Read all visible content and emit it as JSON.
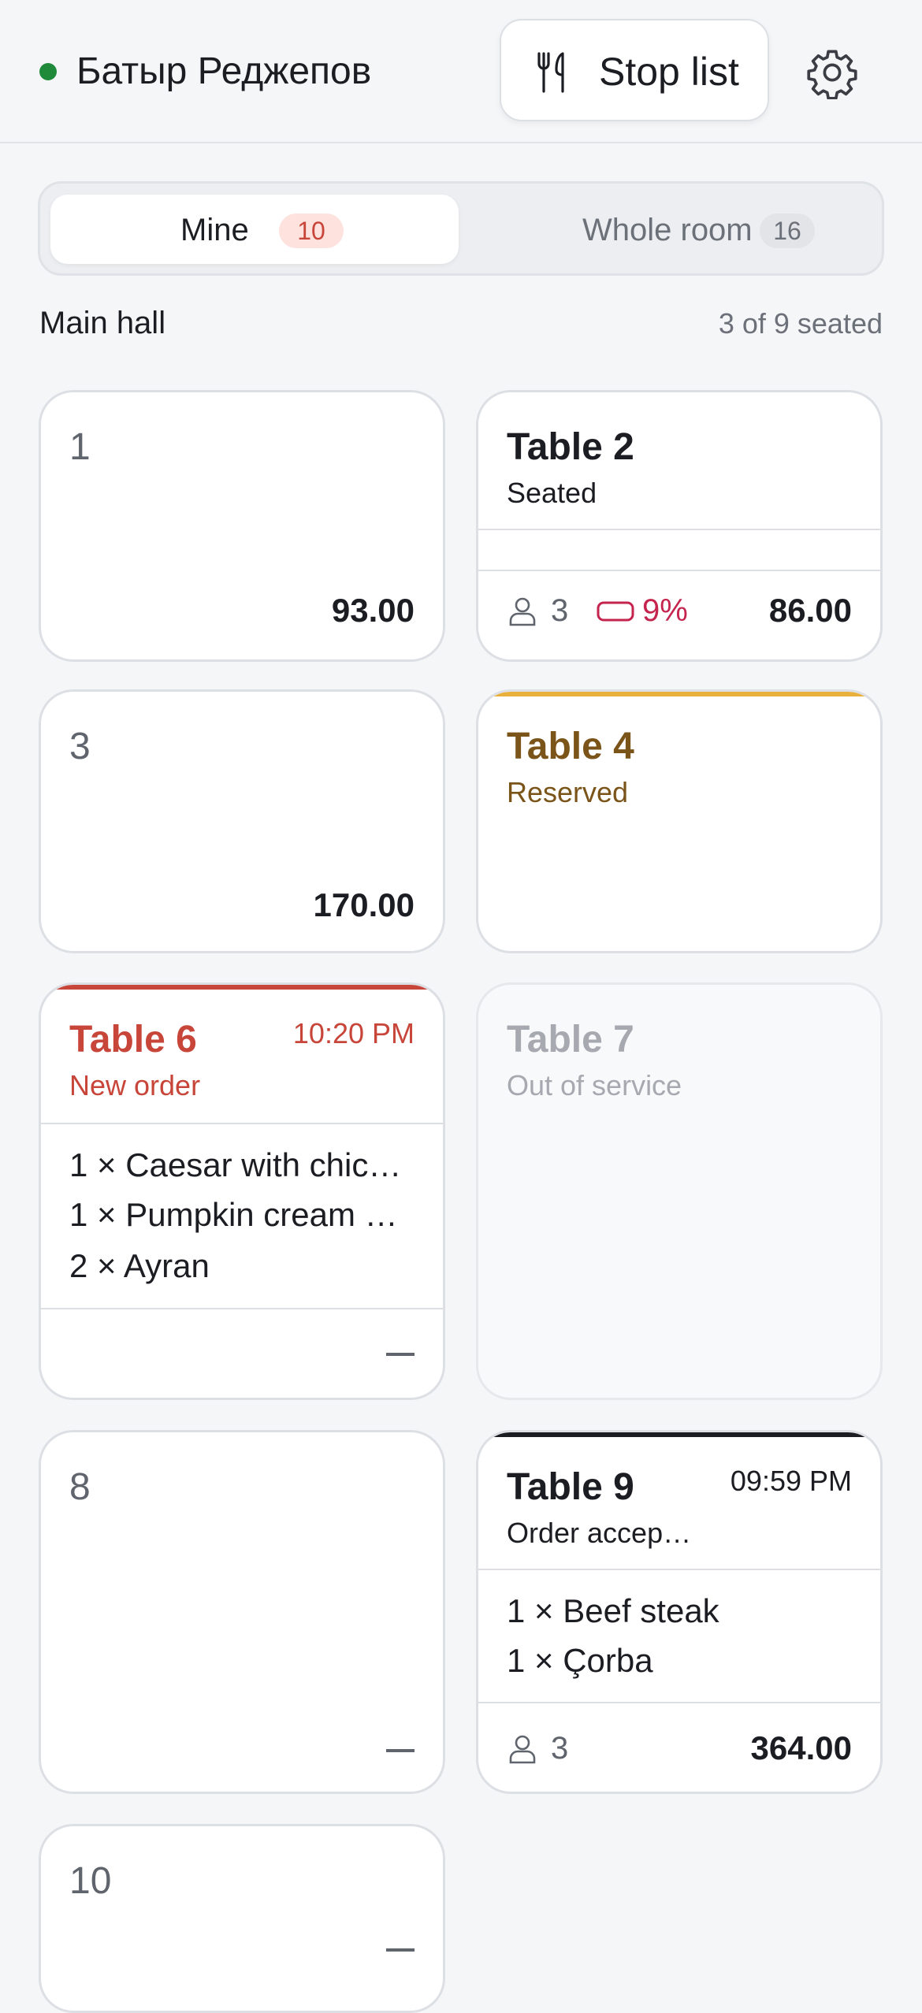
{
  "header": {
    "user_name": "Батыр Реджепов",
    "status_color": "#1e8a3a",
    "stop_list_label": "Stop list",
    "stop_list_icon": "fork-knife-icon",
    "settings_icon": "gear-icon"
  },
  "tabs": {
    "mine": {
      "label": "Mine",
      "count": "10"
    },
    "whole_room": {
      "label": "Whole room",
      "count": "16"
    }
  },
  "section": {
    "title": "Main hall",
    "seated_summary": "3 of 9 seated"
  },
  "tables": {
    "t1": {
      "number": "1",
      "amount": "93.00"
    },
    "t2": {
      "title": "Table 2",
      "status": "Seated",
      "guests": "3",
      "discount": "9%",
      "amount": "86.00"
    },
    "t3": {
      "number": "3",
      "amount": "170.00"
    },
    "t4": {
      "title": "Table 4",
      "status": "Reserved",
      "accent": "#e9b13c"
    },
    "t6": {
      "title": "Table 6",
      "status": "New order",
      "time": "10:20 PM",
      "accent": "#c8453a",
      "items": [
        "1 × Caesar with chic…",
        "1 × Pumpkin cream …",
        "2 × Ayran"
      ]
    },
    "t7": {
      "title": "Table 7",
      "status": "Out of service"
    },
    "t8": {
      "number": "8"
    },
    "t9": {
      "title": "Table 9",
      "status": "Order accep…",
      "time": "09:59 PM",
      "accent": "#1c1d22",
      "items": [
        "1 × Beef steak",
        "1 × Çorba"
      ],
      "guests": "3",
      "amount": "364.00"
    },
    "t10": {
      "number": "10"
    }
  }
}
